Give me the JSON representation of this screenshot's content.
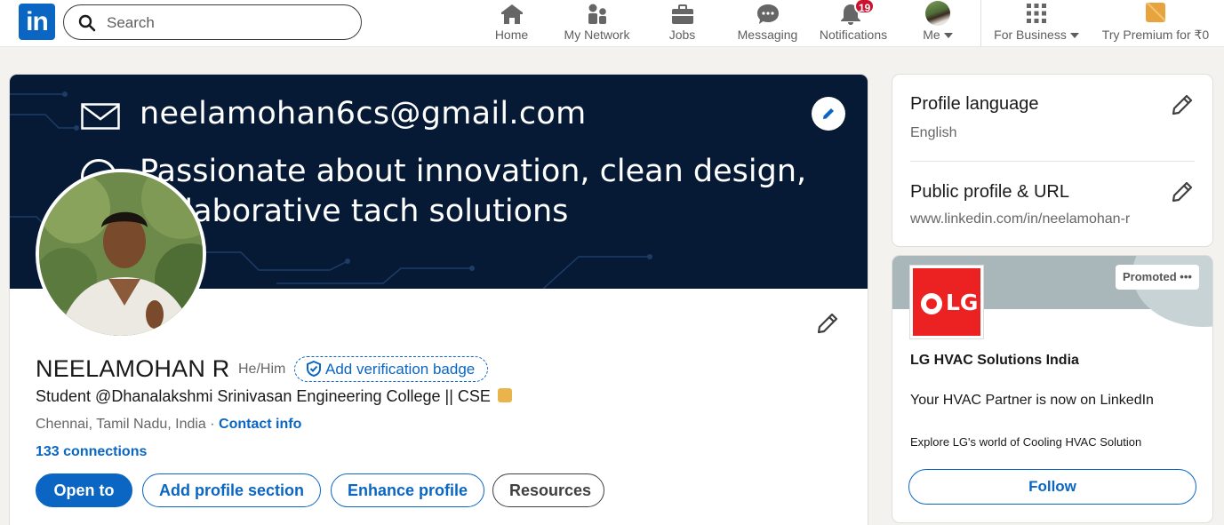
{
  "nav": {
    "logo_text": "in",
    "search_placeholder": "Search",
    "items": [
      {
        "label": "Home",
        "icon": "home-icon"
      },
      {
        "label": "My Network",
        "icon": "network-icon"
      },
      {
        "label": "Jobs",
        "icon": "briefcase-icon"
      },
      {
        "label": "Messaging",
        "icon": "messaging-icon"
      },
      {
        "label": "Notifications",
        "icon": "bell-icon",
        "badge": "19"
      },
      {
        "label": "Me",
        "icon": "avatar"
      },
      {
        "label": "For Business",
        "icon": "grid-icon"
      },
      {
        "label": "Try Premium for ₹0",
        "icon": "premium-icon"
      }
    ]
  },
  "profile": {
    "banner": {
      "email": "neelamohan6cs@gmail.com",
      "line1": "Passionate about innovation, clean design,",
      "line2": "collaborative tach solutions"
    },
    "name": "NEELAMOHAN R",
    "pronouns": "He/Him",
    "verify_label": "Add verification badge",
    "headline": "Student @Dhanalakshmi Srinivasan Engineering College || CSE",
    "location": "Chennai, Tamil Nadu, India",
    "separator": " · ",
    "contact_label": "Contact info",
    "connections": "133 connections",
    "buttons": {
      "open_to": "Open to",
      "add_section": "Add profile section",
      "enhance": "Enhance profile",
      "resources": "Resources"
    }
  },
  "sidebar": {
    "language_title": "Profile language",
    "language_value": "English",
    "url_title": "Public profile & URL",
    "url_value": "www.linkedin.com/in/neelamohan-r"
  },
  "ad": {
    "promoted": "Promoted",
    "more": "•••",
    "logo_text": "LG",
    "company": "LG HVAC Solutions India",
    "tagline": "Your HVAC Partner is now on LinkedIn",
    "description": "Explore LG's world of Cooling HVAC Solution",
    "follow_label": "Follow"
  },
  "colors": {
    "brand": "#0a66c2",
    "banner": "#061a36",
    "notification": "#cb112d",
    "lg_red": "#ec2222"
  }
}
